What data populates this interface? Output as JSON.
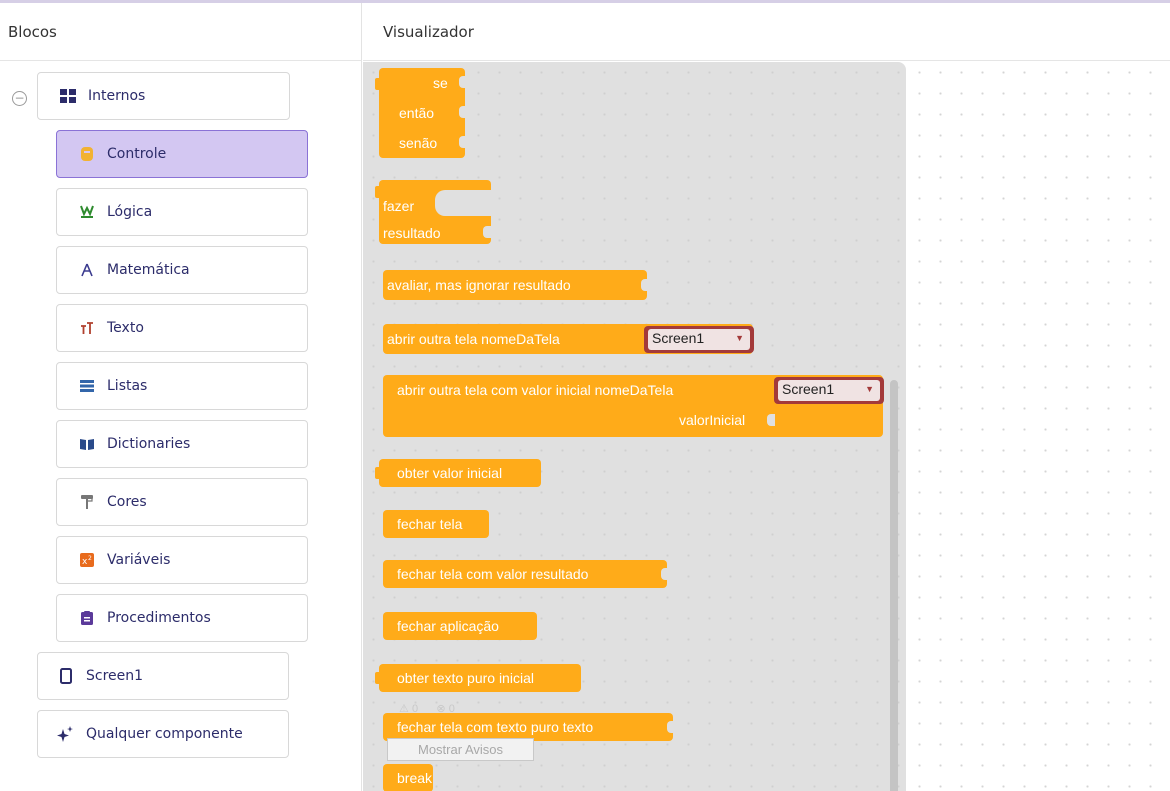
{
  "sidebar": {
    "title": "Blocos",
    "builtin_label": "Internos",
    "items": [
      {
        "label": "Controle",
        "icon": "control-icon",
        "color": "#f2b233"
      },
      {
        "label": "Lógica",
        "icon": "logic-icon",
        "color": "#2e8b2e"
      },
      {
        "label": "Matemática",
        "icon": "math-icon",
        "color": "#3b3b8f"
      },
      {
        "label": "Texto",
        "icon": "text-icon",
        "color": "#b0402e"
      },
      {
        "label": "Listas",
        "icon": "list-icon",
        "color": "#3366aa"
      },
      {
        "label": "Dictionaries",
        "icon": "dictionary-icon",
        "color": "#2a4a8a"
      },
      {
        "label": "Cores",
        "icon": "color-icon",
        "color": "#777777"
      },
      {
        "label": "Variáveis",
        "icon": "variable-icon",
        "color": "#e86b1d"
      },
      {
        "label": "Procedimentos",
        "icon": "procedure-icon",
        "color": "#5b3a9a"
      }
    ],
    "screen_label": "Screen1",
    "any_component_label": "Qualquer componente"
  },
  "workspace": {
    "title": "Visualizador",
    "blocks": {
      "if_se": "se",
      "if_entao": "então",
      "if_senao": "senão",
      "do_fazer": "fazer",
      "do_resultado": "resultado",
      "evaluate": "avaliar, mas ignorar resultado",
      "open_screen": "abrir outra tela  nomeDaTela",
      "open_screen_dd": "Screen1",
      "open_screen_value": "abrir outra tela com valor inicial  nomeDaTela",
      "open_screen_value_dd": "Screen1",
      "open_screen_value_param": "valorInicial",
      "get_start_value": "obter valor inicial",
      "close_screen": "fechar tela",
      "close_screen_value": "fechar tela com valor  resultado",
      "close_app": "fechar aplicação",
      "get_plain_text": "obter texto puro inicial",
      "close_plain_text": "fechar tela com texto puro  texto",
      "break": "break"
    },
    "warnings_count": "0",
    "errors_count": "0",
    "show_warnings_label": "Mostrar Avisos",
    "accent_color": "#ffab19"
  }
}
